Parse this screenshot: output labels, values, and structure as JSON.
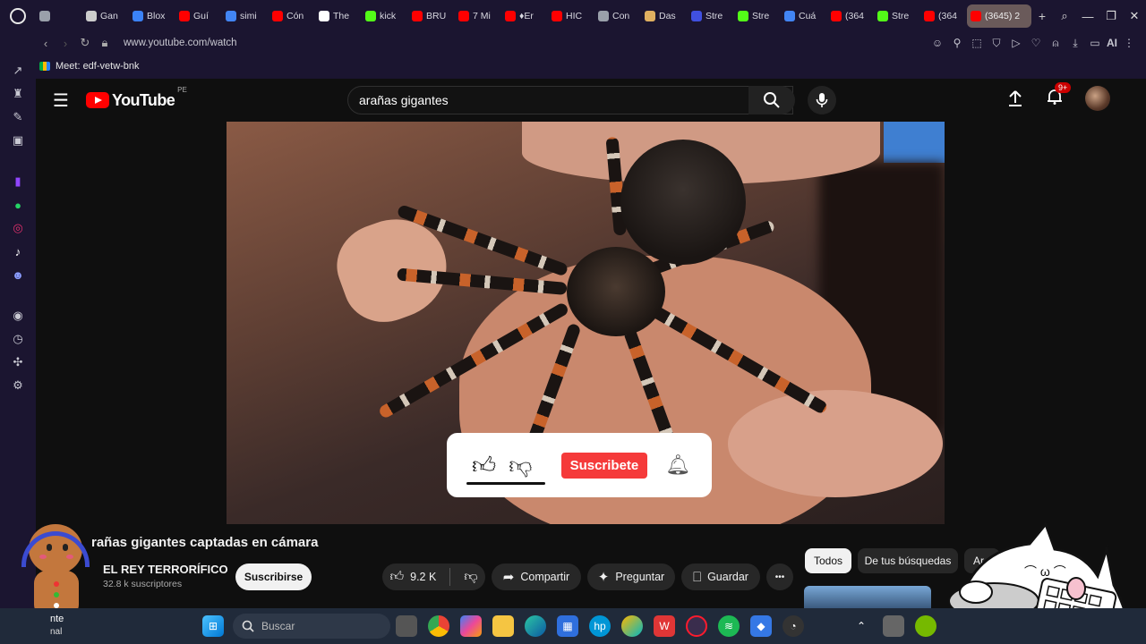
{
  "browser": {
    "tabs": [
      {
        "label": "",
        "color": "#9aa0aa"
      },
      {
        "label": "Gan",
        "color": "#cccccc"
      },
      {
        "label": "Blox",
        "color": "#3b82f6"
      },
      {
        "label": "Guí",
        "color": "#ff0000"
      },
      {
        "label": "simi",
        "color": "#4285f4"
      },
      {
        "label": "Cón",
        "color": "#ff0000"
      },
      {
        "label": "The",
        "color": "#ffffff"
      },
      {
        "label": "kick",
        "color": "#53fc18"
      },
      {
        "label": "BRU",
        "color": "#ff0000"
      },
      {
        "label": "7 Mi",
        "color": "#ff0000"
      },
      {
        "label": "♦Er",
        "color": "#ff0000"
      },
      {
        "label": "HIC",
        "color": "#ff0000"
      },
      {
        "label": "Con",
        "color": "#9aa0aa"
      },
      {
        "label": "Das",
        "color": "#e0b060"
      },
      {
        "label": "Stre",
        "color": "#4050e0"
      },
      {
        "label": "Stre",
        "color": "#53fc18"
      },
      {
        "label": "Cuá",
        "color": "#4285f4"
      },
      {
        "label": "(364",
        "color": "#ff0000"
      },
      {
        "label": "Stre",
        "color": "#53fc18"
      },
      {
        "label": "(364",
        "color": "#ff0000"
      }
    ],
    "active_tab": {
      "label": "(3645) 2",
      "color": "#ff0000"
    },
    "url": "www.youtube.com/watch",
    "meet_label": "Meet: edf-vetw-bnk",
    "ai_label": "AI"
  },
  "youtube": {
    "logo_text": "YouTube",
    "region": "PE",
    "search_value": "arañas gigantes",
    "notif_badge": "9+",
    "video_title": "rañas gigantes captadas en cámara",
    "channel_name": "EL REY TERRORÍFICO",
    "channel_subs": "32.8 k suscriptores",
    "subscribe_label": "Suscribirse",
    "likes": "9.2 K",
    "share_label": "Compartir",
    "ask_label": "Preguntar",
    "save_label": "Guardar",
    "more_label": "•••",
    "overlay_subscribe": "Suscribete",
    "chips": [
      "Todos",
      "De tus búsquedas",
      "Ar"
    ]
  },
  "taskbar": {
    "search_placeholder": "Buscar",
    "left_text_1": "nte",
    "left_text_2": "nal"
  }
}
